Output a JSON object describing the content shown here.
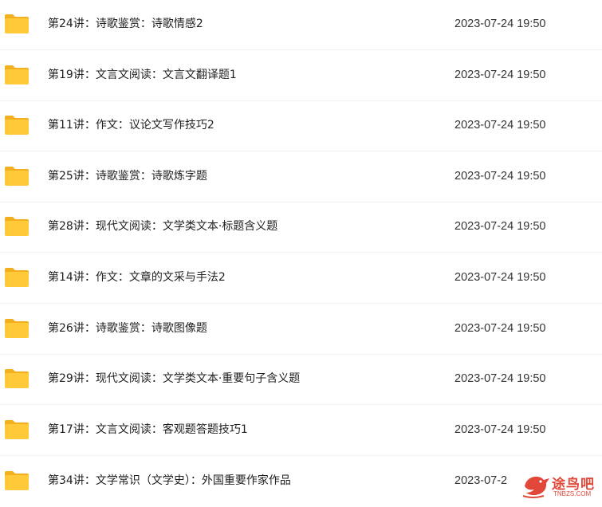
{
  "files": [
    {
      "name": "第24讲：诗歌鉴赏：诗歌情感2",
      "date": "2023-07-24 19:50"
    },
    {
      "name": "第19讲：文言文阅读：文言文翻译题1",
      "date": "2023-07-24 19:50"
    },
    {
      "name": "第11讲：作文：议论文写作技巧2",
      "date": "2023-07-24 19:50"
    },
    {
      "name": "第25讲：诗歌鉴赏：诗歌炼字题",
      "date": "2023-07-24 19:50"
    },
    {
      "name": "第28讲：现代文阅读：文学类文本·标题含义题",
      "date": "2023-07-24 19:50"
    },
    {
      "name": "第14讲：作文：文章的文采与手法2",
      "date": "2023-07-24 19:50"
    },
    {
      "name": "第26讲：诗歌鉴赏：诗歌图像题",
      "date": "2023-07-24 19:50"
    },
    {
      "name": "第29讲：现代文阅读：文学类文本·重要句子含义题",
      "date": "2023-07-24 19:50"
    },
    {
      "name": "第17讲：文言文阅读：客观题答题技巧1",
      "date": "2023-07-24 19:50"
    },
    {
      "name": "第34讲：文学常识（文学史）：外国重要作家作品",
      "date": "2023-07-2"
    }
  ],
  "icons": {
    "folder": "folder-icon"
  },
  "colors": {
    "folder_body": "#FFC93A",
    "folder_tab": "#F2B01E",
    "watermark": "#E2483A"
  },
  "watermark": {
    "text": "途鸟吧",
    "subtext": "TNBZS.COM"
  }
}
